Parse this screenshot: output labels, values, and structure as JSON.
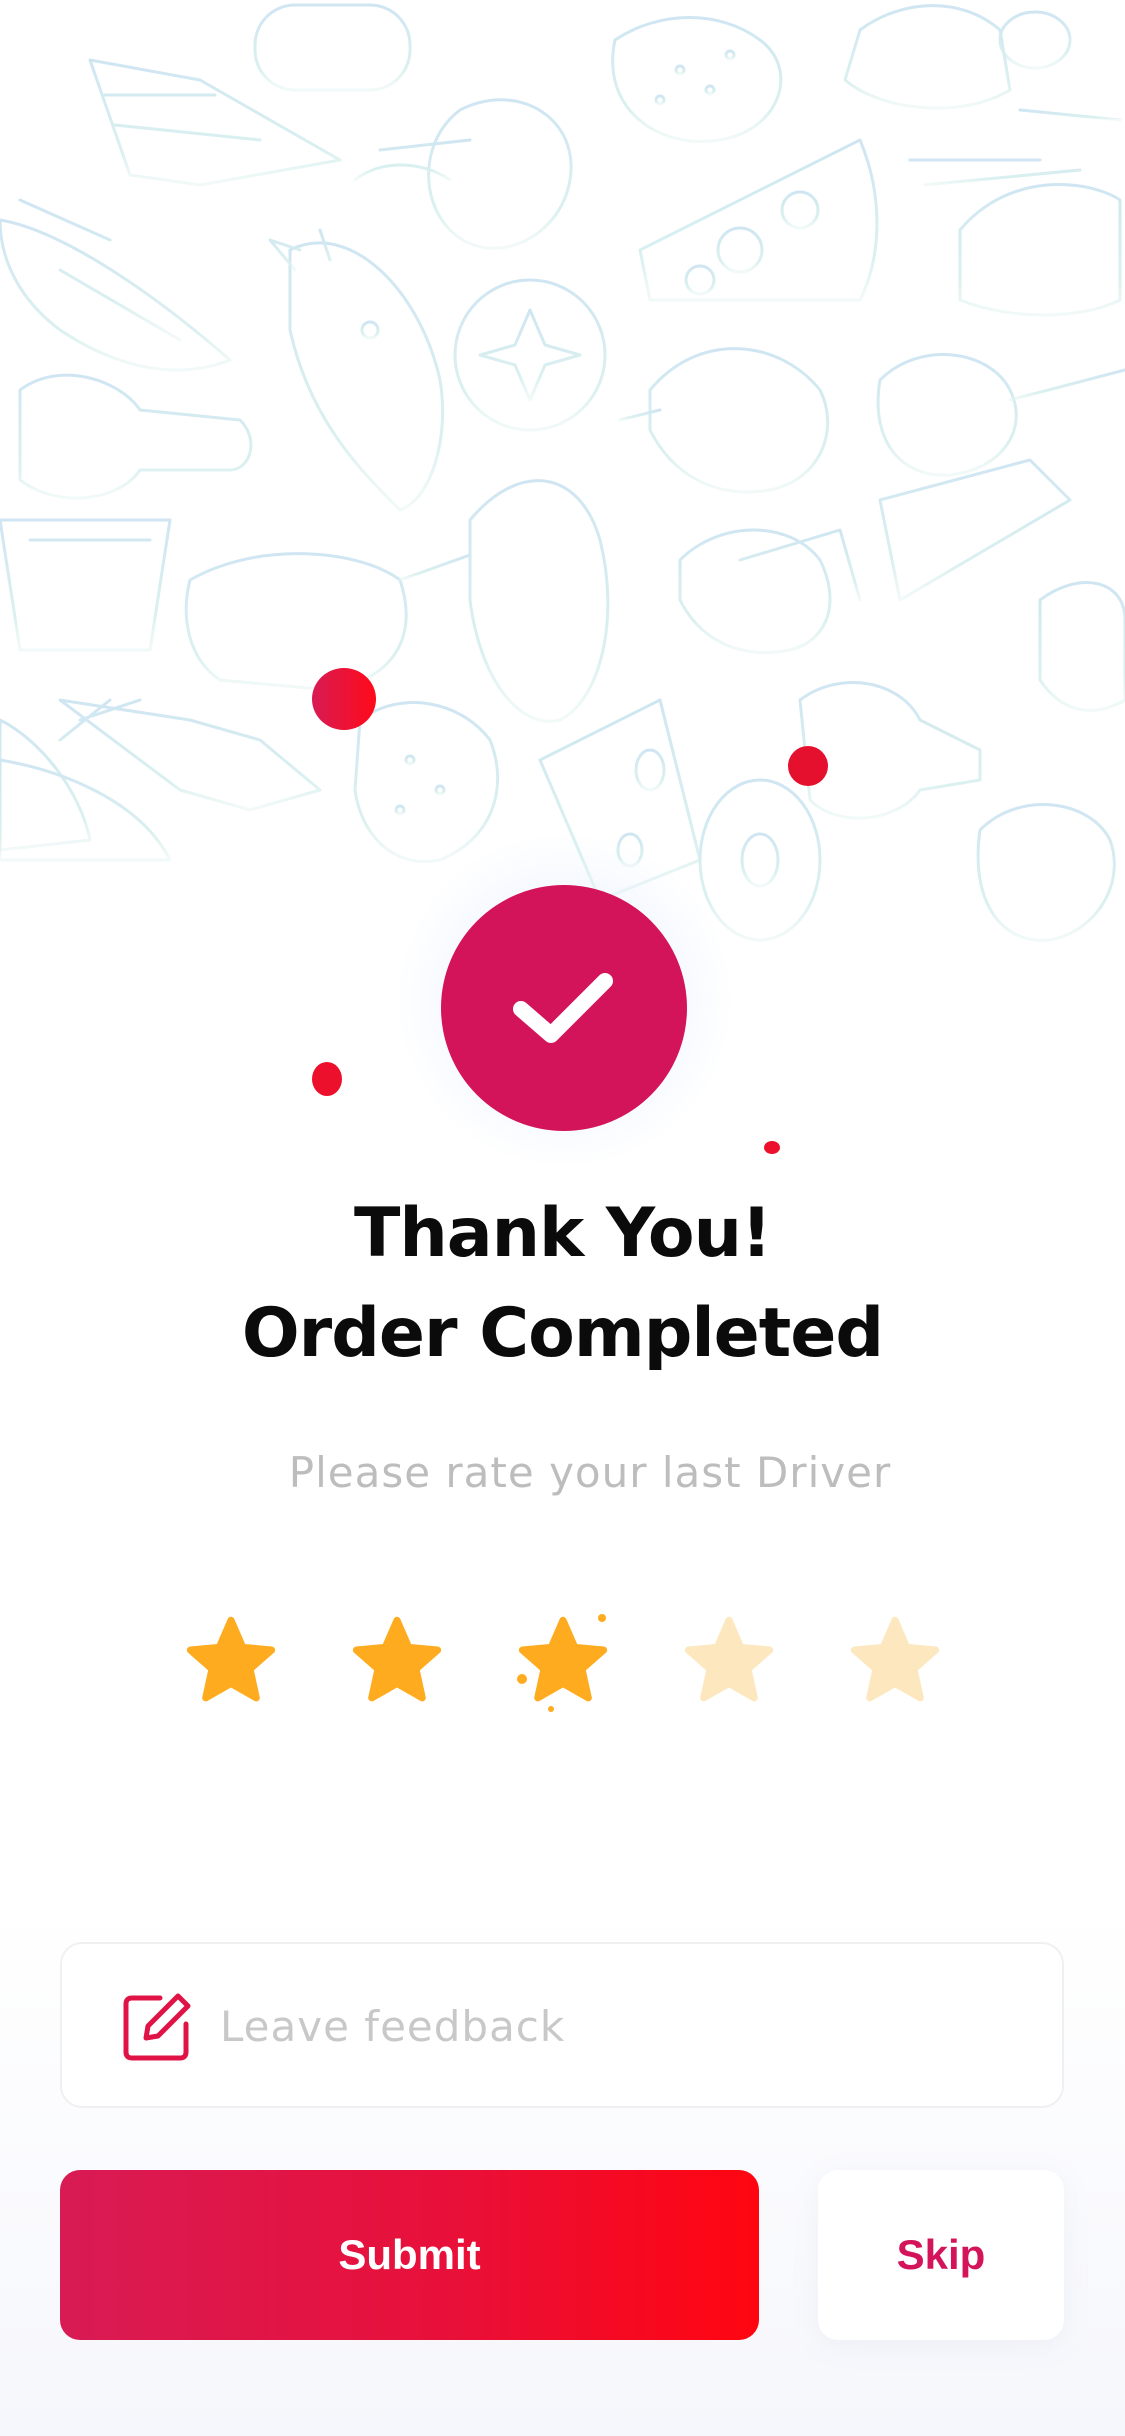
{
  "thankyou": {
    "line1": "Thank You!",
    "line2": "Order Completed"
  },
  "rating": {
    "prompt": "Please rate your last Driver",
    "value": 3,
    "max": 5
  },
  "feedback": {
    "placeholder": "Leave feedback"
  },
  "actions": {
    "submit_label": "Submit",
    "skip_label": "Skip"
  },
  "colors": {
    "accent": "#d4145a",
    "star_active": "#ffab1f",
    "star_inactive": "#fde7bf",
    "doodle": "#cfe7ee"
  }
}
